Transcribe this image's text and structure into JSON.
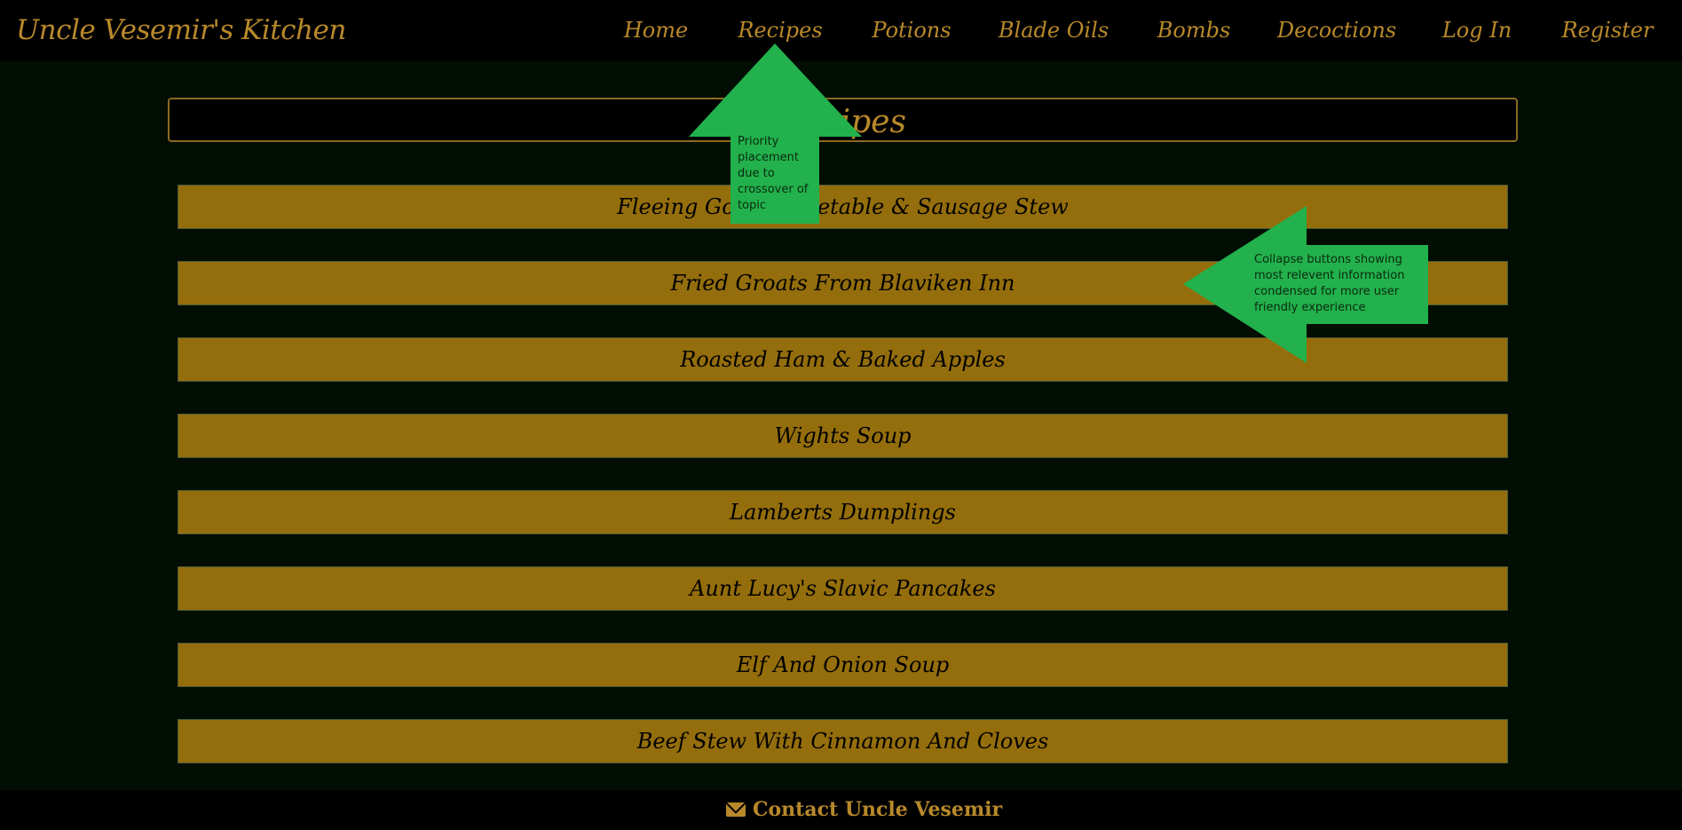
{
  "navbar": {
    "brand": "Uncle Vesemir's Kitchen",
    "items": [
      {
        "label": "Home"
      },
      {
        "label": "Recipes"
      },
      {
        "label": "Potions"
      },
      {
        "label": "Blade Oils"
      },
      {
        "label": "Bombs"
      },
      {
        "label": "Decoctions"
      },
      {
        "label": "Log In"
      },
      {
        "label": "Register"
      }
    ]
  },
  "page": {
    "title": "Recipes"
  },
  "recipes": [
    {
      "label": "Fleeing Goose Vegetable & Sausage Stew"
    },
    {
      "label": "Fried Groats From Blaviken Inn"
    },
    {
      "label": "Roasted Ham & Baked Apples"
    },
    {
      "label": "Wights Soup"
    },
    {
      "label": "Lamberts Dumplings"
    },
    {
      "label": "Aunt Lucy's Slavic Pancakes"
    },
    {
      "label": "Elf And Onion Soup"
    },
    {
      "label": "Beef Stew With Cinnamon And Cloves"
    }
  ],
  "footer": {
    "contact_label": "Contact Uncle Vesemir",
    "icon": "envelope-icon"
  },
  "annotations": {
    "priority_note": "Priority placement due to crossover of topic",
    "collapse_note": "Collapse buttons showing most relevent information condensed for more user friendly experience"
  },
  "colors": {
    "gold": "#b8892a",
    "button": "#946e0c",
    "background": "#020d04",
    "annotation_green": "#22b14c"
  }
}
